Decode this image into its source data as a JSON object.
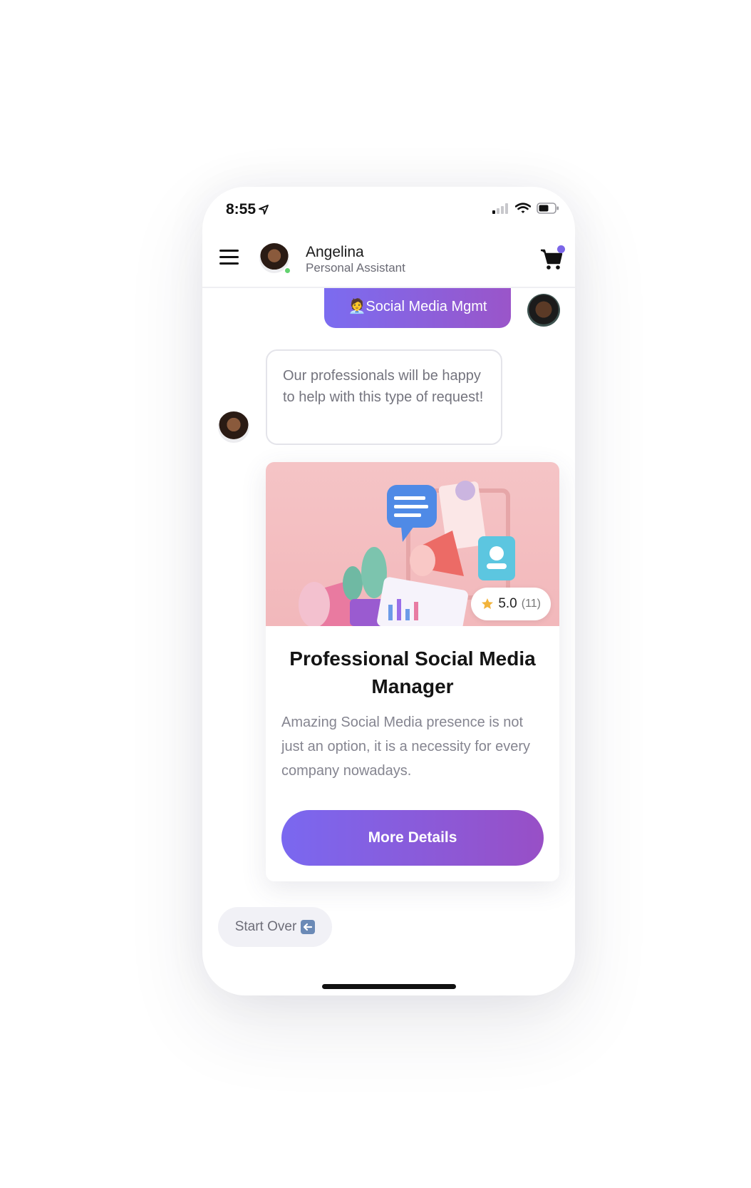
{
  "status": {
    "time": "8:55"
  },
  "header": {
    "agent_name": "Angelina",
    "agent_role": "Personal Assistant"
  },
  "chat": {
    "user_message": "🧑‍💼Social Media Mgmt",
    "bot_message": "Our professionals will be happy to help with this type of request!"
  },
  "card": {
    "rating": "5.0",
    "rating_count": "(11)",
    "title": "Professional Social Media Manager",
    "description": "Amazing Social Media presence is not just an option, it is a necessity for every company nowadays.",
    "button_label": "More Details"
  },
  "start_over_label": "Start Over",
  "colors": {
    "accent_start": "#7b6cf0",
    "accent_end": "#9a55c9",
    "online": "#62d26f",
    "cart_badge": "#7b66e8"
  }
}
